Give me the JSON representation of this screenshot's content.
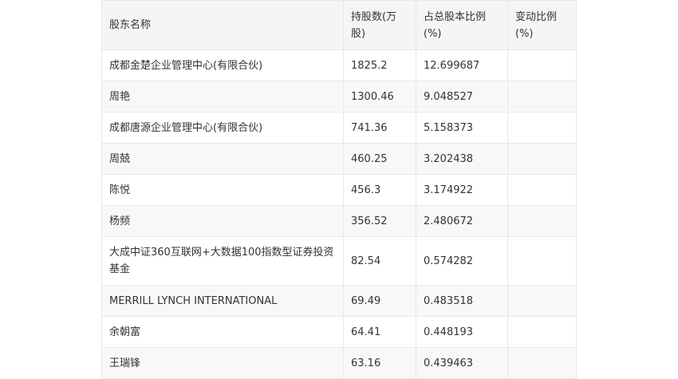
{
  "table": {
    "headers": [
      "股东名称",
      "持股数(万股)",
      "占总股本比例(%)",
      "变动比例(%)"
    ],
    "rows": [
      [
        "成都金楚企业管理中心(有限合伙)",
        "1825.2",
        "12.699687",
        ""
      ],
      [
        "周艳",
        "1300.46",
        "9.048527",
        ""
      ],
      [
        "成都唐源企业管理中心(有限合伙)",
        "741.36",
        "5.158373",
        ""
      ],
      [
        "周兢",
        "460.25",
        "3.202438",
        ""
      ],
      [
        "陈悦",
        "456.3",
        "3.174922",
        ""
      ],
      [
        "杨频",
        "356.52",
        "2.480672",
        ""
      ],
      [
        "大成中证360互联网+大数据100指数型证券投资基金",
        "82.54",
        "0.574282",
        ""
      ],
      [
        "MERRILL LYNCH INTERNATIONAL",
        "69.49",
        "0.483518",
        ""
      ],
      [
        "余朝富",
        "64.41",
        "0.448193",
        ""
      ],
      [
        "王瑞锋",
        "63.16",
        "0.439463",
        ""
      ]
    ]
  }
}
